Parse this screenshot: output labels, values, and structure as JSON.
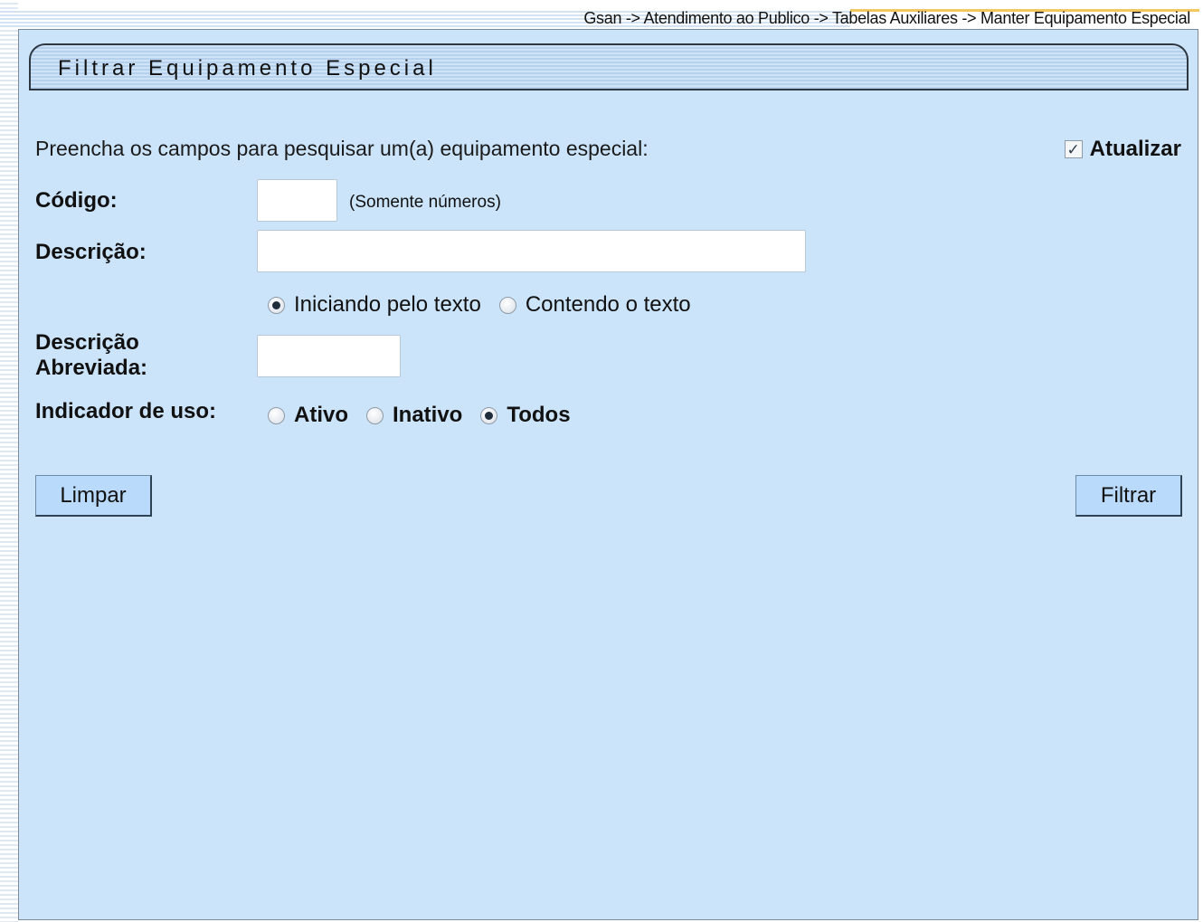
{
  "breadcrumb": "Gsan -> Atendimento ao Publico -> Tabelas Auxiliares -> Manter Equipamento Especial",
  "panel": {
    "title": "Filtrar Equipamento Especial",
    "intro": "Preencha os campos para pesquisar um(a) equipamento especial:",
    "atualizar": {
      "label": "Atualizar",
      "checked": true,
      "check_glyph": "✓"
    }
  },
  "form": {
    "codigo": {
      "label": "Código:",
      "value": "",
      "hint": "(Somente números)"
    },
    "descricao": {
      "label": "Descrição:",
      "value": "",
      "options": [
        {
          "label": "Iniciando pelo texto",
          "checked": true
        },
        {
          "label": "Contendo o texto",
          "checked": false
        }
      ]
    },
    "descricao_abreviada": {
      "label_line1": "Descrição",
      "label_line2": "Abreviada:",
      "value": ""
    },
    "indicador_uso": {
      "label": "Indicador de uso:",
      "options": [
        {
          "label": "Ativo",
          "checked": false
        },
        {
          "label": "Inativo",
          "checked": false
        },
        {
          "label": "Todos",
          "checked": true
        }
      ]
    }
  },
  "buttons": {
    "limpar": "Limpar",
    "filtrar": "Filtrar"
  },
  "colors": {
    "panel_bg": "#cce4fa",
    "button_bg": "#b9dafb",
    "accent_gold": "#f3c760"
  }
}
